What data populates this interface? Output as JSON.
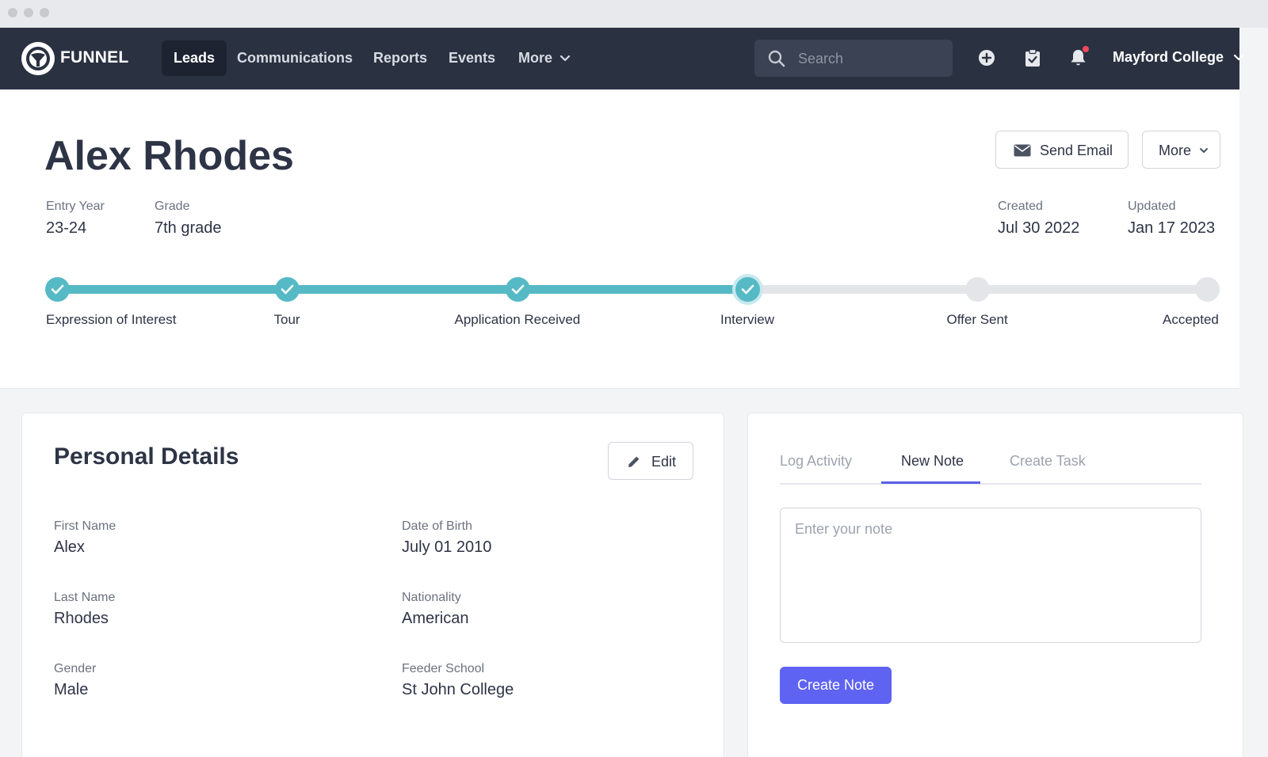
{
  "nav": {
    "brand": "FUNNEL",
    "links": [
      "Leads",
      "Communications",
      "Reports",
      "Events",
      "More"
    ],
    "search_placeholder": "Search",
    "organization": "Mayford College"
  },
  "lead": {
    "name": "Alex Rhodes",
    "actions": {
      "send_email": "Send Email",
      "more": "More"
    },
    "meta": {
      "entry_year_label": "Entry Year",
      "entry_year": "23-24",
      "grade_label": "Grade",
      "grade": "7th grade",
      "created_label": "Created",
      "created": "Jul 30 2022",
      "updated_label": "Updated",
      "updated": "Jan 17 2023"
    },
    "pipeline": {
      "stages": [
        {
          "label": "Expression of Interest",
          "status": "complete"
        },
        {
          "label": "Tour",
          "status": "complete"
        },
        {
          "label": "Application Received",
          "status": "complete"
        },
        {
          "label": "Interview",
          "status": "current"
        },
        {
          "label": "Offer Sent",
          "status": "pending"
        },
        {
          "label": "Accepted",
          "status": "pending"
        }
      ],
      "accent_color": "#56b9c6"
    }
  },
  "personal_details": {
    "title": "Personal Details",
    "edit_label": "Edit",
    "fields": [
      {
        "label": "First Name",
        "value": "Alex"
      },
      {
        "label": "Date of Birth",
        "value": "July 01 2010"
      },
      {
        "label": "Last Name",
        "value": "Rhodes"
      },
      {
        "label": "Nationality",
        "value": "American"
      },
      {
        "label": "Gender",
        "value": "Male"
      },
      {
        "label": "Feeder School",
        "value": "St John College"
      }
    ]
  },
  "activity": {
    "tabs": [
      "Log Activity",
      "New Note",
      "Create Task"
    ],
    "active_tab": "New Note",
    "note_placeholder": "Enter your note",
    "create_label": "Create Note",
    "accent_color": "#5f63f2"
  }
}
